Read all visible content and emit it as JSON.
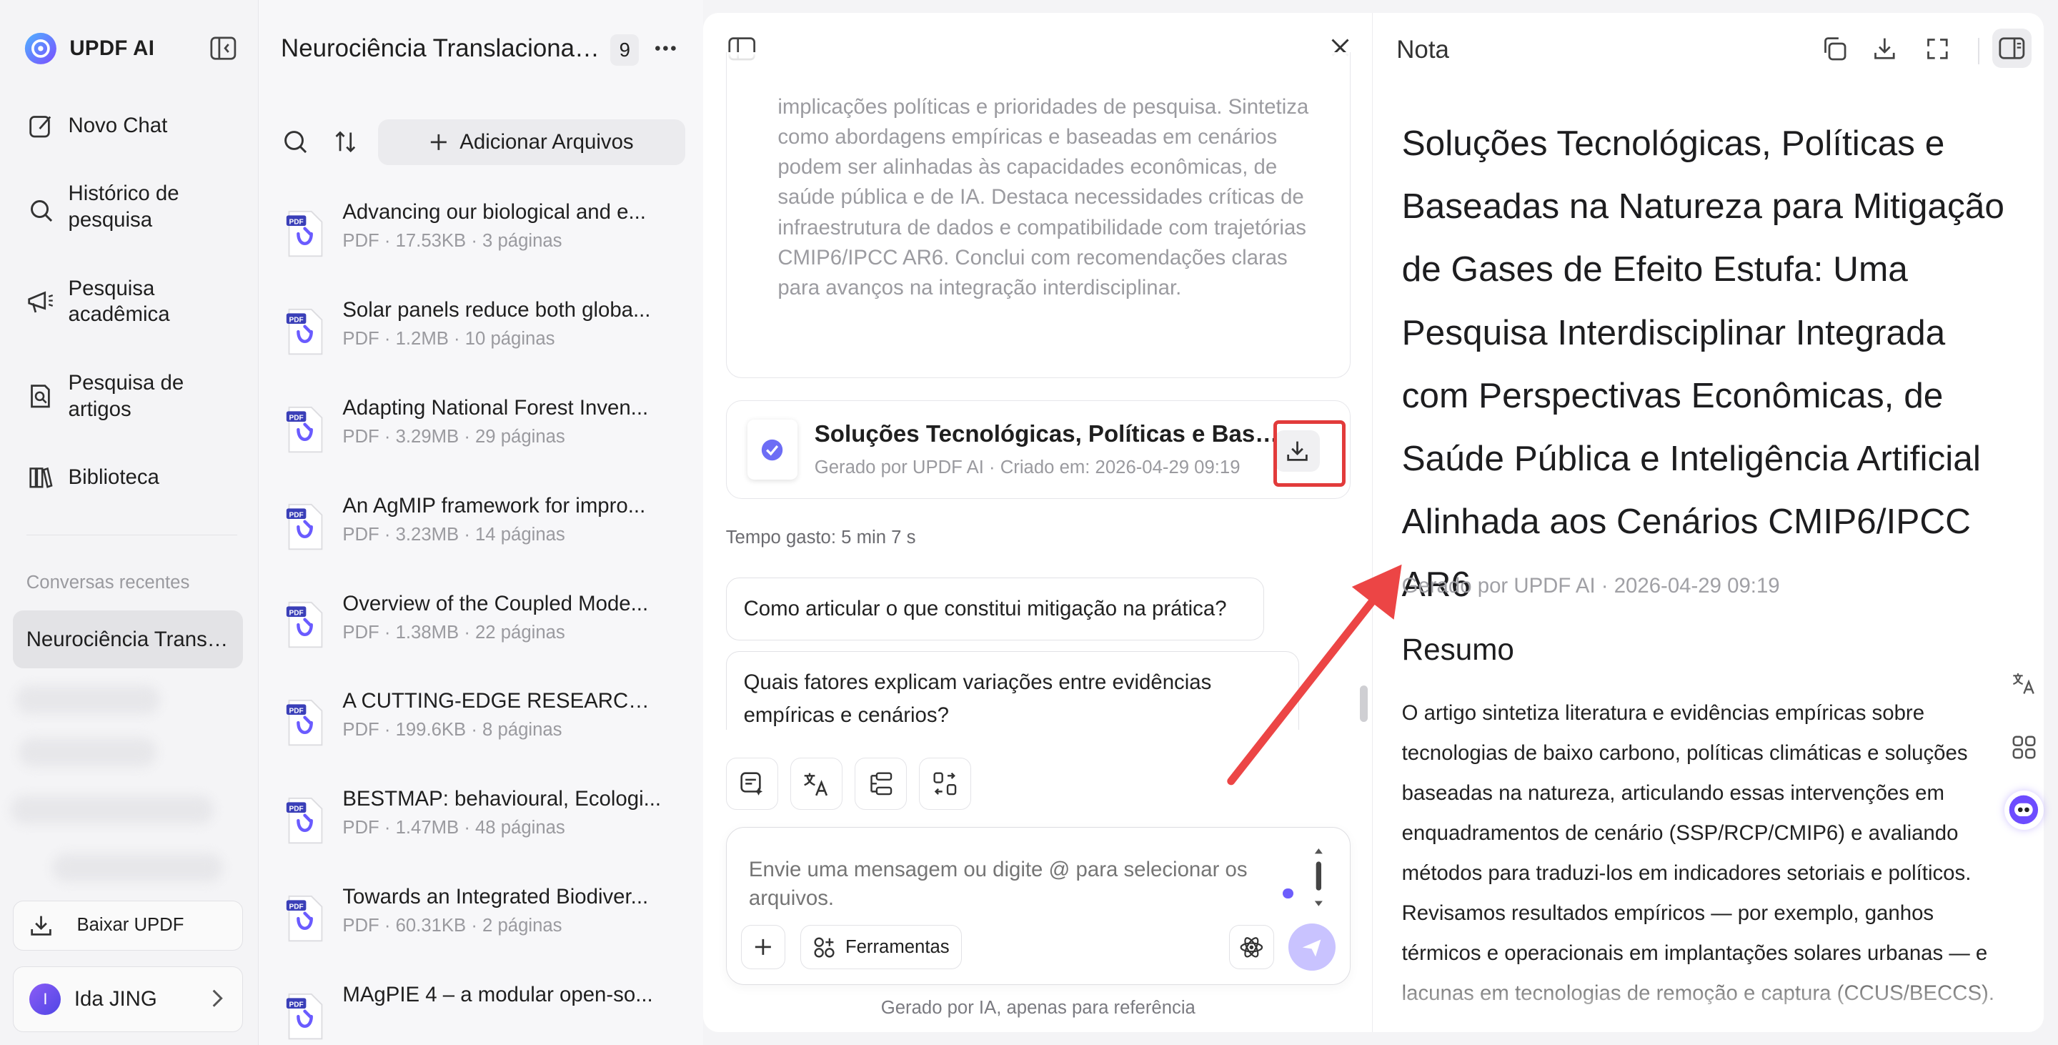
{
  "sidebar": {
    "brand": "UPDF AI",
    "nav": [
      {
        "label": "Novo Chat",
        "icon": "new-chat-icon"
      },
      {
        "label": "Histórico de pesquisa",
        "icon": "search-icon"
      },
      {
        "label": "Pesquisa acadêmica",
        "icon": "megaphone-icon"
      },
      {
        "label": "Pesquisa de artigos",
        "icon": "document-search-icon"
      },
      {
        "label": "Biblioteca",
        "icon": "library-icon"
      }
    ],
    "recent_title": "Conversas recentes",
    "recent_active": "Neurociência Translacional ...",
    "download_label": "Baixar UPDF",
    "user_initial": "I",
    "user_name": "Ida JING"
  },
  "files": {
    "title": "Neurociência Translacional ...",
    "count": "9",
    "add_label": "Adicionar Arquivos",
    "items": [
      {
        "name": "Advancing our biological and e...",
        "meta": "PDF · 17.53KB · 3 páginas"
      },
      {
        "name": "Solar panels reduce both globa...",
        "meta": "PDF · 1.2MB · 10 páginas"
      },
      {
        "name": "Adapting National Forest Inven...",
        "meta": "PDF · 3.29MB · 29 páginas"
      },
      {
        "name": "An AgMIP framework for impro...",
        "meta": "PDF · 3.23MB · 14 páginas"
      },
      {
        "name": "Overview of the Coupled Mode...",
        "meta": "PDF · 1.38MB · 22 páginas"
      },
      {
        "name": "A CUTTING-EDGE RESEARCH O...",
        "meta": "PDF · 199.6KB · 8 páginas"
      },
      {
        "name": "BESTMAP: behavioural, Ecologi...",
        "meta": "PDF · 1.47MB · 48 páginas"
      },
      {
        "name": "Towards an Integrated Biodiver...",
        "meta": "PDF · 60.31KB · 2 páginas"
      },
      {
        "name": "MAgPIE 4 – a modular open-so...",
        "meta": ""
      }
    ],
    "file_badge": "PDF"
  },
  "chat": {
    "quote_text": "implicações políticas e prioridades de pesquisa. Sintetiza como abordagens empíricas e baseadas em cenários podem ser alinhadas às capacidades econômicas, de saúde pública e de IA. Destaca necessidades críticas de infraestrutura de dados e compatibilidade com trajetórias CMIP6/IPCC AR6. Conclui com recomendações claras para avanços na integração interdisciplinar.",
    "generated_title": "Soluções Tecnológicas, Políticas e Baseadas na Natureza para Mitigação de Gases de Efeito Estufa",
    "generated_meta": "Gerado por UPDF AI · Criado em: 2026-04-29 09:19",
    "time_spent": "Tempo gasto: 5 min 7 s",
    "suggestions": [
      "Como articular o que constitui mitigação na prática?",
      "Quais fatores explicam variações entre evidências empíricas e cenários?"
    ],
    "input_placeholder": "Envie uma mensagem ou digite @ para selecionar os arquivos.",
    "tools_label": "Ferramentas",
    "footer": "Gerado por IA, apenas para referência"
  },
  "note": {
    "label": "Nota",
    "title": "Soluções Tecnológicas, Políticas e Baseadas na Natureza para Mitigação de Gases de Efeito Estufa: Uma Pesquisa Interdisciplinar Integrada com Perspectivas Econômicas, de Saúde Pública e Inteligência Artificial Alinhada aos Cenários CMIP6/IPCC AR6",
    "meta": "Gerado por UPDF AI · 2026-04-29 09:19",
    "section": "Resumo",
    "body": "O artigo sintetiza literatura e evidências empíricas sobre tecnologias de baixo carbono, políticas climáticas e soluções baseadas na natureza, articulando essas intervenções em enquadramentos de cenário (SSP/RCP/CMIP6) e avaliando métodos para traduzi-los em indicadores setoriais e políticos. Revisamos resultados empíricos — por exemplo, ganhos térmicos e operacionais em implantações solares urbanas — e lacunas em tecnologias de remoção e captura (CCUS/BECCS)."
  },
  "colors": {
    "accent": "#6d5dfc",
    "highlight_red": "#e23b3b"
  }
}
